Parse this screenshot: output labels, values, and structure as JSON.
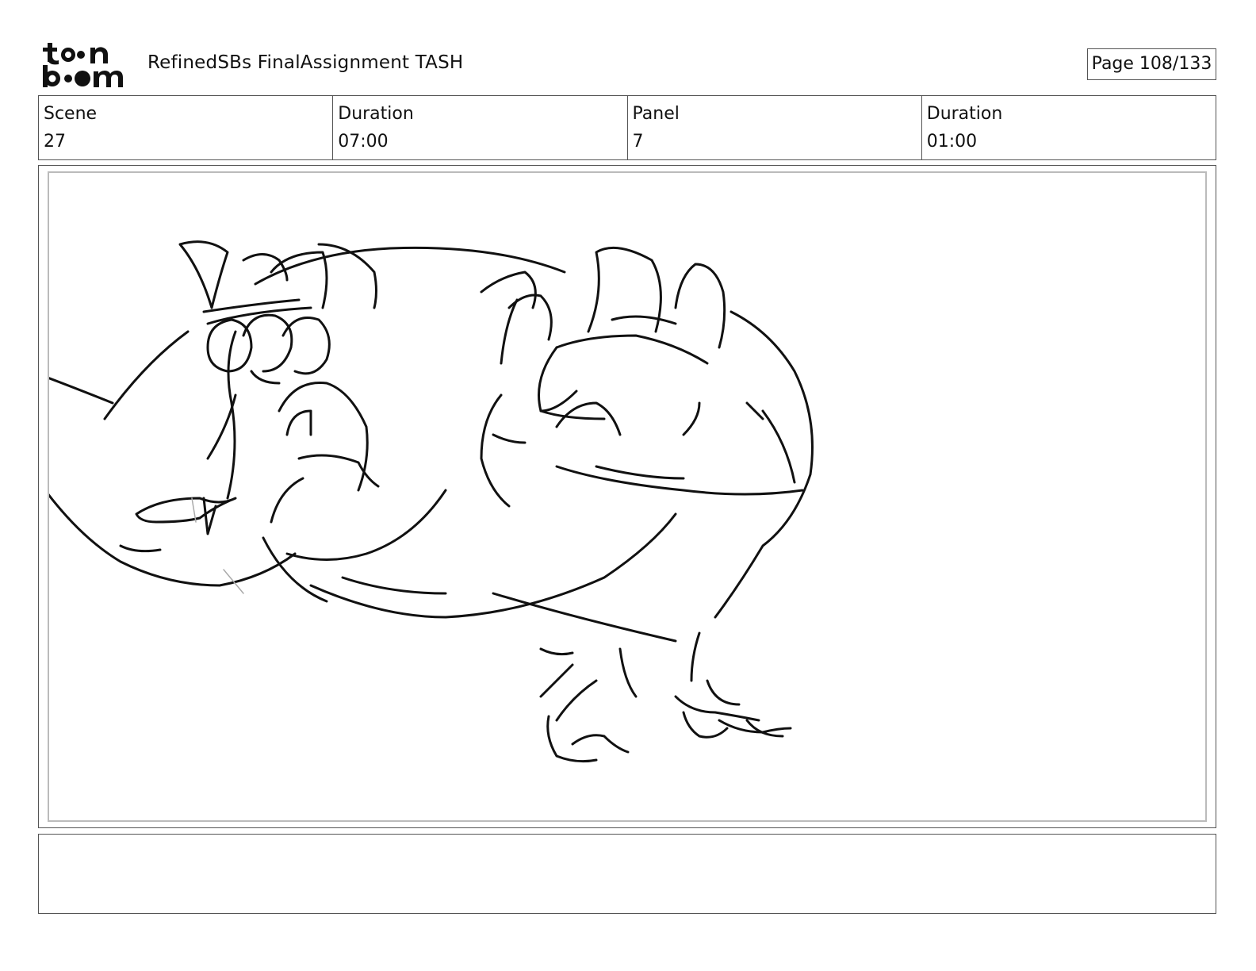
{
  "header": {
    "logo_text": "toon boom",
    "document_title": "RefinedSBs FinalAssignment TASH",
    "page_label": "Page 108/133"
  },
  "info": {
    "scene_label": "Scene",
    "scene_value": "27",
    "scene_duration_label": "Duration",
    "scene_duration_value": "07:00",
    "panel_label": "Panel",
    "panel_value": "7",
    "panel_duration_label": "Duration",
    "panel_duration_value": "01:00"
  },
  "notes": {
    "text": ""
  },
  "colors": {
    "ink": "#111111",
    "border": "#555555",
    "inner_border": "#bbbbbb",
    "background": "#ffffff"
  }
}
